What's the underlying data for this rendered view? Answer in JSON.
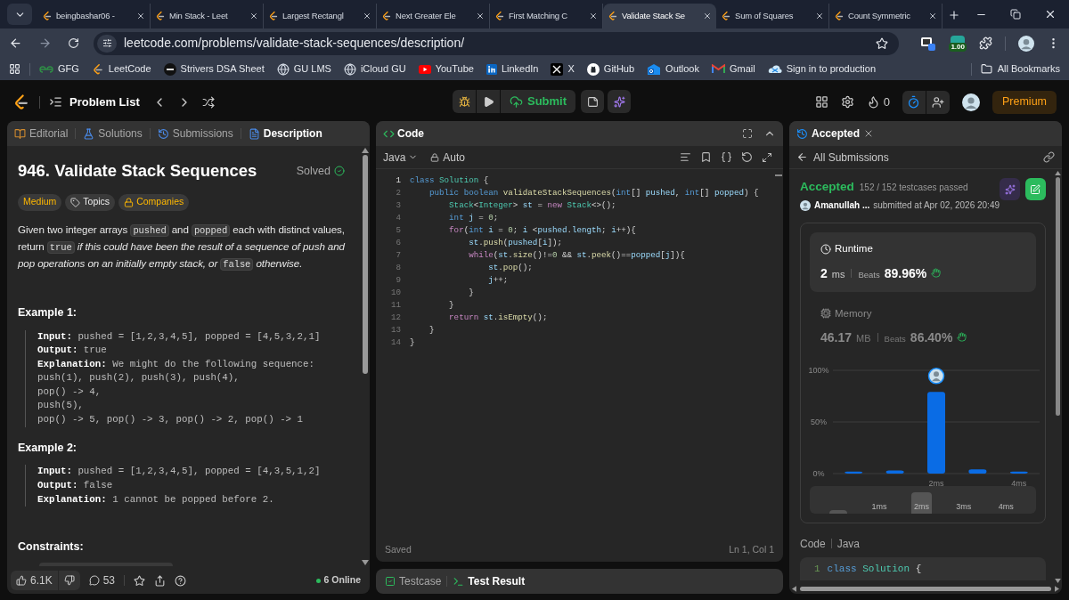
{
  "browser": {
    "tabs": [
      {
        "title": "beingbashar06 -",
        "selected": false
      },
      {
        "title": "Min Stack - Leet",
        "selected": false
      },
      {
        "title": "Largest Rectangl",
        "selected": false
      },
      {
        "title": "Next Greater Ele",
        "selected": false
      },
      {
        "title": "First Matching C",
        "selected": false
      },
      {
        "title": "Validate Stack Se",
        "selected": true
      },
      {
        "title": "Sum of Squares",
        "selected": false
      },
      {
        "title": "Count Symmetric",
        "selected": false
      }
    ],
    "url": "leetcode.com/problems/validate-stack-sequences/description/",
    "extension_badge": "1.00",
    "bookmarks": [
      {
        "label": "GFG",
        "kind": "gfg"
      },
      {
        "label": "LeetCode",
        "kind": "leetcode"
      },
      {
        "label": "Strivers DSA Sheet",
        "kind": "strivers"
      },
      {
        "label": "GU LMS",
        "kind": "globe"
      },
      {
        "label": "iCloud GU",
        "kind": "globe"
      },
      {
        "label": "YouTube",
        "kind": "youtube"
      },
      {
        "label": "LinkedIn",
        "kind": "linkedin"
      },
      {
        "label": "X",
        "kind": "x"
      },
      {
        "label": "GitHub",
        "kind": "github"
      },
      {
        "label": "Outlook",
        "kind": "outlook"
      },
      {
        "label": "Gmail",
        "kind": "gmail"
      },
      {
        "label": "Sign in to production",
        "kind": "cloud"
      }
    ],
    "all_bookmarks": "All Bookmarks"
  },
  "nav": {
    "problem_list": "Problem List",
    "submit": "Submit",
    "streak": "0",
    "premium": "Premium"
  },
  "description_panel": {
    "tabs": [
      {
        "label": "Editorial",
        "kind": "editorial",
        "selected": false
      },
      {
        "label": "Solutions",
        "kind": "solutions",
        "selected": false
      },
      {
        "label": "Submissions",
        "kind": "submissions",
        "selected": false
      },
      {
        "label": "Description",
        "kind": "description",
        "selected": true
      }
    ],
    "title": "946. Validate Stack Sequences",
    "status": "Solved",
    "tags": [
      {
        "label": "Medium",
        "kind": "difficulty"
      },
      {
        "label": "Topics",
        "kind": "topics"
      },
      {
        "label": "Companies",
        "kind": "companies"
      }
    ],
    "statement": [
      {
        "kind": "text",
        "text": "Given two integer arrays "
      },
      {
        "kind": "code",
        "text": "pushed"
      },
      {
        "kind": "text",
        "text": " and "
      },
      {
        "kind": "code",
        "text": "popped"
      },
      {
        "kind": "text",
        "text": " each with distinct values, return "
      },
      {
        "kind": "code",
        "text": "true"
      },
      {
        "kind": "em",
        "text": " if this could have been the result of a sequence of push and pop operations on an initially empty stack, or "
      },
      {
        "kind": "code",
        "text": "false"
      },
      {
        "kind": "em",
        "text": " otherwise."
      }
    ],
    "examples": [
      {
        "heading": "Example 1:",
        "lines": [
          {
            "label": "Input:",
            "value": "pushed = [1,2,3,4,5], popped = [4,5,3,2,1]"
          },
          {
            "label": "Output:",
            "value": "true"
          },
          {
            "label": "Explanation:",
            "value": "We might do the following sequence:"
          },
          {
            "value": "push(1), push(2), push(3), push(4),"
          },
          {
            "value": "pop() -> 4,"
          },
          {
            "value": "push(5),"
          },
          {
            "value": "pop() -> 5, pop() -> 3, pop() -> 2, pop() -> 1"
          }
        ]
      },
      {
        "heading": "Example 2:",
        "lines": [
          {
            "label": "Input:",
            "value": "pushed = [1,2,3,4,5], popped = [4,3,5,1,2]"
          },
          {
            "label": "Output:",
            "value": "false"
          },
          {
            "label": "Explanation:",
            "value": "1 cannot be popped before 2."
          }
        ]
      }
    ],
    "constraints_heading": "Constraints:",
    "footer": {
      "likes": "6.1K",
      "comments": "53",
      "online": "6 Online"
    }
  },
  "editor": {
    "title": "Code",
    "language": "Java",
    "mode": "Auto",
    "lines": [
      {
        "number": "1",
        "tokens": [
          {
            "kind": "kw",
            "text": "class "
          },
          {
            "kind": "type",
            "text": "Solution"
          },
          {
            "kind": "p",
            "text": " {"
          }
        ]
      },
      {
        "number": "2",
        "tokens": [
          {
            "kind": "kw",
            "text": "    public boolean "
          },
          {
            "kind": "fn",
            "text": "validateStackSequences"
          },
          {
            "kind": "p",
            "text": "("
          },
          {
            "kind": "kw",
            "text": "int"
          },
          {
            "kind": "p",
            "text": "[] "
          },
          {
            "kind": "var",
            "text": "pushed"
          },
          {
            "kind": "p",
            "text": ", "
          },
          {
            "kind": "kw",
            "text": "int"
          },
          {
            "kind": "p",
            "text": "[] "
          },
          {
            "kind": "var",
            "text": "popped"
          },
          {
            "kind": "p",
            "text": ") {"
          }
        ]
      },
      {
        "number": "3",
        "tokens": [
          {
            "kind": "type",
            "text": "        Stack"
          },
          {
            "kind": "p",
            "text": "<"
          },
          {
            "kind": "type",
            "text": "Integer"
          },
          {
            "kind": "p",
            "text": "> "
          },
          {
            "kind": "var",
            "text": "st"
          },
          {
            "kind": "p",
            "text": " = "
          },
          {
            "kind": "ctl",
            "text": "new "
          },
          {
            "kind": "type",
            "text": "Stack"
          },
          {
            "kind": "p",
            "text": "<>();"
          }
        ]
      },
      {
        "number": "4",
        "tokens": [
          {
            "kind": "kw",
            "text": "        int "
          },
          {
            "kind": "var",
            "text": "j"
          },
          {
            "kind": "p",
            "text": " = "
          },
          {
            "kind": "num",
            "text": "0"
          },
          {
            "kind": "p",
            "text": ";"
          }
        ]
      },
      {
        "number": "5",
        "tokens": [
          {
            "kind": "ctl",
            "text": "        for"
          },
          {
            "kind": "p",
            "text": "("
          },
          {
            "kind": "kw",
            "text": "int "
          },
          {
            "kind": "var",
            "text": "i"
          },
          {
            "kind": "p",
            "text": " = "
          },
          {
            "kind": "num",
            "text": "0"
          },
          {
            "kind": "p",
            "text": "; "
          },
          {
            "kind": "var",
            "text": "i"
          },
          {
            "kind": "p",
            "text": " <"
          },
          {
            "kind": "var",
            "text": "pushed"
          },
          {
            "kind": "p",
            "text": "."
          },
          {
            "kind": "var",
            "text": "length"
          },
          {
            "kind": "p",
            "text": "; "
          },
          {
            "kind": "var",
            "text": "i"
          },
          {
            "kind": "p",
            "text": "++){"
          }
        ]
      },
      {
        "number": "6",
        "tokens": [
          {
            "kind": "var",
            "text": "            st"
          },
          {
            "kind": "p",
            "text": "."
          },
          {
            "kind": "fn",
            "text": "push"
          },
          {
            "kind": "p",
            "text": "("
          },
          {
            "kind": "var",
            "text": "pushed"
          },
          {
            "kind": "p",
            "text": "["
          },
          {
            "kind": "var",
            "text": "i"
          },
          {
            "kind": "p",
            "text": "]);"
          }
        ]
      },
      {
        "number": "7",
        "tokens": [
          {
            "kind": "ctl",
            "text": "            while"
          },
          {
            "kind": "p",
            "text": "("
          },
          {
            "kind": "var",
            "text": "st"
          },
          {
            "kind": "p",
            "text": "."
          },
          {
            "kind": "fn",
            "text": "size"
          },
          {
            "kind": "p",
            "text": "()!="
          },
          {
            "kind": "num",
            "text": "0"
          },
          {
            "kind": "p",
            "text": " && "
          },
          {
            "kind": "var",
            "text": "st"
          },
          {
            "kind": "p",
            "text": "."
          },
          {
            "kind": "fn",
            "text": "peek"
          },
          {
            "kind": "p",
            "text": "()=="
          },
          {
            "kind": "var",
            "text": "popped"
          },
          {
            "kind": "p",
            "text": "["
          },
          {
            "kind": "var",
            "text": "j"
          },
          {
            "kind": "p",
            "text": "]){"
          }
        ]
      },
      {
        "number": "8",
        "tokens": [
          {
            "kind": "var",
            "text": "                st"
          },
          {
            "kind": "p",
            "text": "."
          },
          {
            "kind": "fn",
            "text": "pop"
          },
          {
            "kind": "p",
            "text": "();"
          }
        ]
      },
      {
        "number": "9",
        "tokens": [
          {
            "kind": "var",
            "text": "                j"
          },
          {
            "kind": "p",
            "text": "++;"
          }
        ]
      },
      {
        "number": "10",
        "tokens": [
          {
            "kind": "p",
            "text": "            }"
          }
        ]
      },
      {
        "number": "11",
        "tokens": [
          {
            "kind": "p",
            "text": "        }"
          }
        ]
      },
      {
        "number": "12",
        "tokens": [
          {
            "kind": "ctl",
            "text": "        return "
          },
          {
            "kind": "var",
            "text": "st"
          },
          {
            "kind": "p",
            "text": "."
          },
          {
            "kind": "fn",
            "text": "isEmpty"
          },
          {
            "kind": "p",
            "text": "();"
          }
        ]
      },
      {
        "number": "13",
        "tokens": [
          {
            "kind": "p",
            "text": "    }"
          }
        ]
      },
      {
        "number": "14",
        "tokens": [
          {
            "kind": "p",
            "text": "}"
          }
        ]
      }
    ],
    "save_status": "Saved",
    "cursor": "Ln 1, Col 1",
    "bottom_tabs": [
      {
        "label": "Testcase",
        "selected": false
      },
      {
        "label": "Test Result",
        "selected": true
      }
    ]
  },
  "result_panel": {
    "tab": "Accepted",
    "back": "All Submissions",
    "status": "Accepted",
    "testcases": "152 / 152 testcases passed",
    "user": "Amanullah ...",
    "submitted": "submitted at Apr 02, 2026 20:49",
    "metrics": [
      {
        "label": "Runtime",
        "kind": "runtime",
        "value": "2",
        "unit": "ms",
        "beats_label": "Beats",
        "beats": "89.96%",
        "selected": true
      },
      {
        "label": "Memory",
        "kind": "memory",
        "value": "46.17",
        "unit": "MB",
        "beats_label": "Beats",
        "beats": "86.40%",
        "selected": false
      }
    ],
    "chart_data": {
      "type": "bar",
      "x": [
        0,
        1,
        2,
        3,
        4
      ],
      "xlim": [
        -0.5,
        4.5
      ],
      "values": [
        2,
        3,
        79,
        4,
        2
      ],
      "ylim": [
        0,
        100
      ],
      "yticks": [
        {
          "value": 0,
          "label": "0%"
        },
        {
          "value": 50,
          "label": "50%"
        },
        {
          "value": 100,
          "label": "100%"
        }
      ],
      "xticks": [
        {
          "value": 2,
          "label": "2ms"
        },
        {
          "value": 4,
          "label": "4ms"
        }
      ]
    },
    "range_labels": [
      "1ms",
      "2ms",
      "3ms",
      "4ms"
    ],
    "code_label": "Code",
    "code_language": "Java",
    "code_lines": [
      {
        "number": "1",
        "tokens": [
          {
            "kind": "kw",
            "text": "class "
          },
          {
            "kind": "type",
            "text": "Solution"
          },
          {
            "kind": "p",
            "text": " {"
          }
        ]
      }
    ]
  }
}
